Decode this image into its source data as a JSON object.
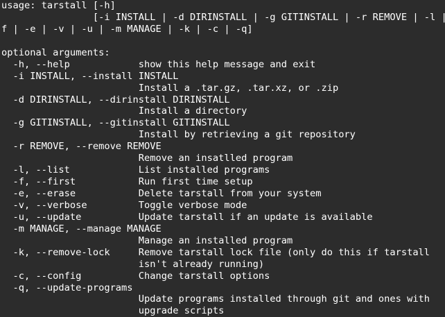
{
  "terminal": {
    "lines": [
      "usage: tarstall [-h]",
      "                [-i INSTALL | -d DIRINSTALL | -g GITINSTALL | -r REMOVE | -l | -",
      "f | -e | -v | -u | -m MANAGE | -k | -c | -q]",
      "",
      "optional arguments:",
      "  -h, --help            show this help message and exit",
      "  -i INSTALL, --install INSTALL",
      "                        Install a .tar.gz, .tar.xz, or .zip",
      "  -d DIRINSTALL, --dirinstall DIRINSTALL",
      "                        Install a directory",
      "  -g GITINSTALL, --gitinstall GITINSTALL",
      "                        Install by retrieving a git repository",
      "  -r REMOVE, --remove REMOVE",
      "                        Remove an insatlled program",
      "  -l, --list            List installed programs",
      "  -f, --first           Run first time setup",
      "  -e, --erase           Delete tarstall from your system",
      "  -v, --verbose         Toggle verbose mode",
      "  -u, --update          Update tarstall if an update is available",
      "  -m MANAGE, --manage MANAGE",
      "                        Manage an installed program",
      "  -k, --remove-lock     Remove tarstall lock file (only do this if tarstall",
      "                        isn't already running)",
      "  -c, --config          Change tarstall options",
      "  -q, --update-programs",
      "                        Update programs installed through git and ones with",
      "                        upgrade scripts"
    ]
  },
  "colors": {
    "background": "#2c2c2c",
    "text": "#ffffff"
  }
}
